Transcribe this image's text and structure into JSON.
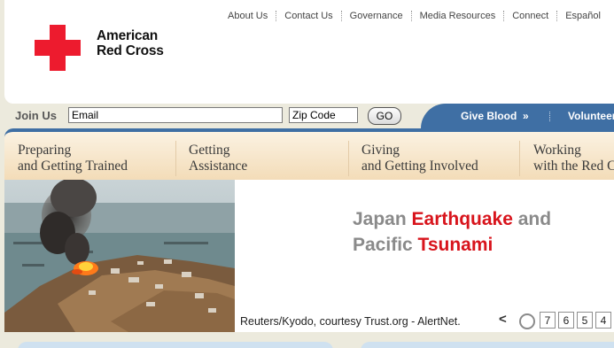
{
  "logo": {
    "line1": "American",
    "line2": "Red Cross"
  },
  "topnav": [
    "About Us",
    "Contact Us",
    "Governance",
    "Media Resources",
    "Connect",
    "Español"
  ],
  "join": {
    "label": "Join Us",
    "email_value": "Email",
    "zip_value": "Zip Code",
    "go_label": "GO"
  },
  "quicklinks": {
    "give_blood": "Give Blood",
    "give_blood_arrow": "»",
    "volunteer": "Volunteer"
  },
  "mainnav": [
    {
      "line1": "Preparing",
      "line2": "and Getting Trained"
    },
    {
      "line1": "Getting",
      "line2": "Assistance"
    },
    {
      "line1": "Giving",
      "line2": "and Getting Involved"
    },
    {
      "line1": "Working",
      "line2": "with the Red Cross"
    }
  ],
  "hero": {
    "headline_l1_pre": "Japan ",
    "headline_l1_red": "Earthquake",
    "headline_l1_post": " and",
    "headline_l2_pre": "Pacific ",
    "headline_l2_red": "Tsunami",
    "caption": "Reuters/Kyodo, courtesy Trust.org - AlertNet.",
    "prev_arrow": "<",
    "pages": [
      "7",
      "6",
      "5",
      "4"
    ]
  },
  "colors": {
    "brand_red": "#ed1b2e",
    "nav_blue": "#3f6fa4",
    "headline_red": "#d8141c"
  }
}
